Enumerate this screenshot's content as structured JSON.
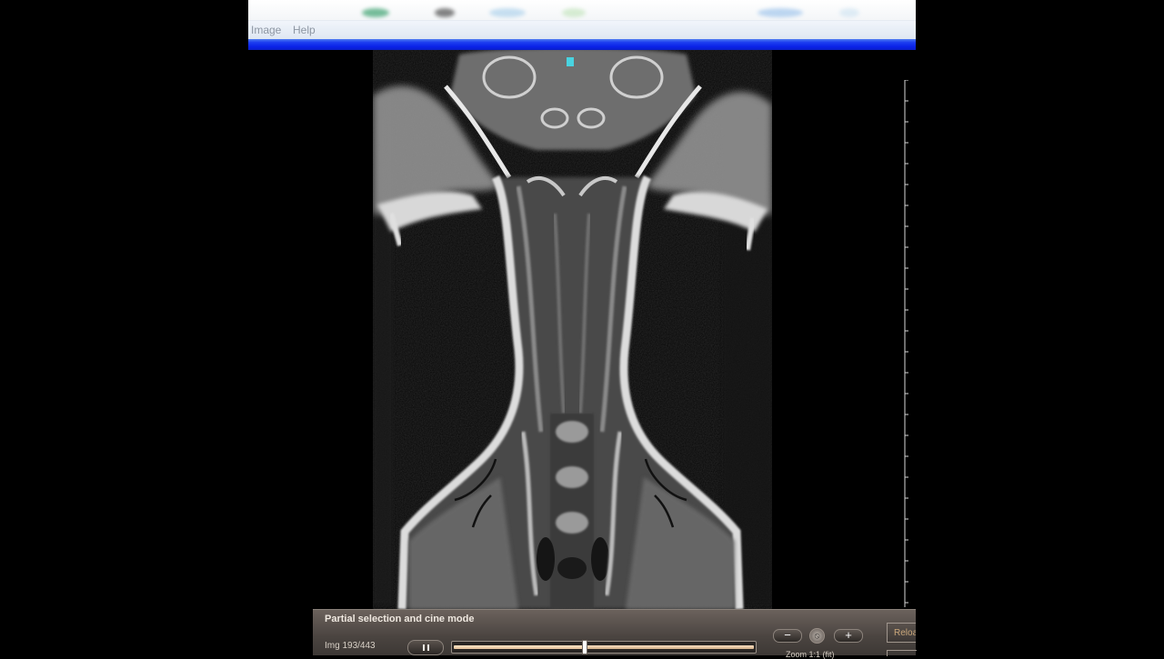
{
  "menu": {
    "items": [
      {
        "label": "Image"
      },
      {
        "label": "Help"
      }
    ]
  },
  "cine_panel": {
    "title": "Partial selection and cine mode",
    "image_counter": "Img 193/443",
    "current_image": 193,
    "total_images": 443,
    "zoom_out_label": "−",
    "zoom_in_label": "+",
    "zoom_reset_label": "⦸",
    "zoom_label": "Zoom 1:1  (fit)",
    "reload_label": "Reload"
  },
  "colors": {
    "title_bar_blue": "#0a22e8",
    "panel_bg": "#4a4440",
    "slider_accent": "#ffe4c4"
  }
}
